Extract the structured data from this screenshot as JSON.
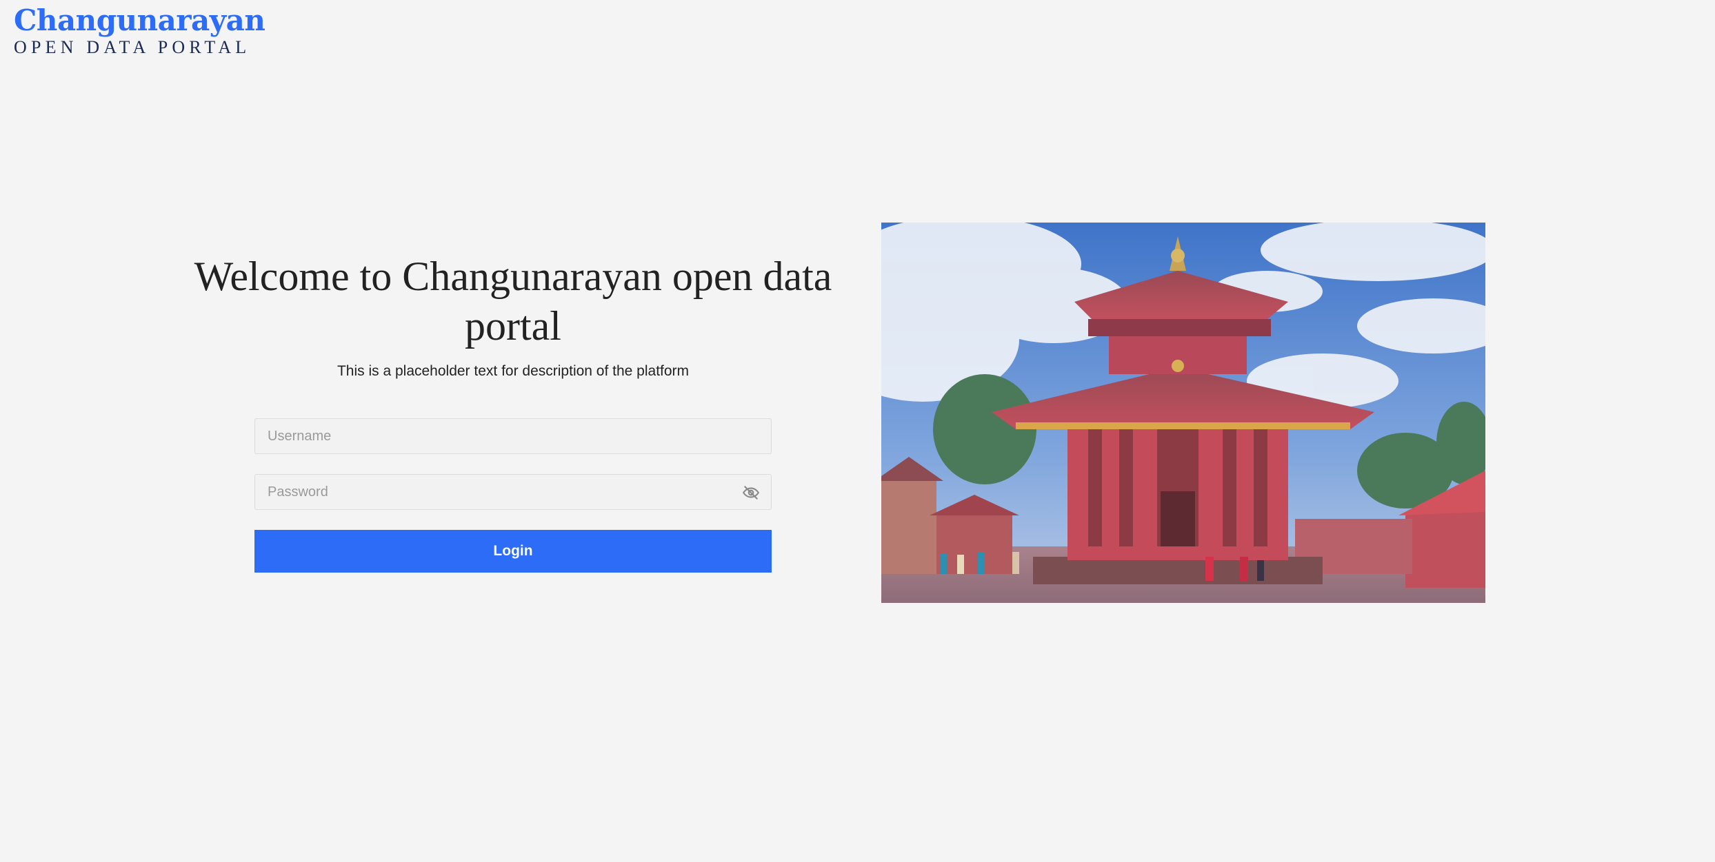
{
  "brand": {
    "name": "Changunarayan",
    "subtitle": "OPEN DATA PORTAL"
  },
  "welcome": {
    "title": "Welcome to Changunarayan open data portal",
    "description": "This is a placeholder text for description of the platform"
  },
  "form": {
    "username_placeholder": "Username",
    "username_value": "",
    "password_placeholder": "Password",
    "password_value": "",
    "login_label": "Login"
  },
  "icons": {
    "password_toggle": "eye-off-icon"
  },
  "colors": {
    "accent": "#2d6cf6",
    "background": "#f4f4f4",
    "text": "#222222",
    "brand_subtitle": "#1b2a55"
  }
}
